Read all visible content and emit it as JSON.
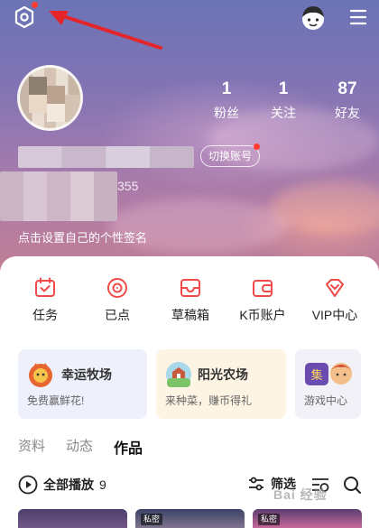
{
  "header": {
    "icons": {
      "settings": "settings-gear-icon",
      "avatar": "cartoon-avatar-icon",
      "menu": "hamburger-menu-icon"
    },
    "accent": "#ff3b30"
  },
  "profile": {
    "stats": [
      {
        "value": "1",
        "label": "粉丝"
      },
      {
        "value": "1",
        "label": "关注"
      },
      {
        "value": "87",
        "label": "好友"
      }
    ],
    "switch_account_label": "切换账号",
    "id_text": "355",
    "bio_prompt": "点击设置自己的个性签名"
  },
  "quick_actions": [
    {
      "label": "任务",
      "icon": "calendar-icon"
    },
    {
      "label": "已点",
      "icon": "vinyl-disc-icon"
    },
    {
      "label": "草稿箱",
      "icon": "inbox-tray-icon"
    },
    {
      "label": "K币账户",
      "icon": "wallet-icon"
    },
    {
      "label": "VIP中心",
      "icon": "diamond-icon"
    }
  ],
  "game_cards": [
    {
      "title": "幸运牧场",
      "subtitle": "免费赢鲜花!"
    },
    {
      "title": "阳光农场",
      "subtitle": "来种菜，赚币得礼"
    },
    {
      "title": "",
      "subtitle": "游戏中心"
    }
  ],
  "tabs": [
    {
      "label": "资料",
      "active": false
    },
    {
      "label": "动态",
      "active": false
    },
    {
      "label": "作品",
      "active": true
    }
  ],
  "works_toolbar": {
    "play_all_label": "全部播放",
    "count": "9",
    "filter_label": "筛选"
  },
  "thumbnails": [
    {
      "badge": ""
    },
    {
      "badge": "私密"
    },
    {
      "badge": "私密"
    }
  ],
  "watermark_text": "Bai 经验"
}
